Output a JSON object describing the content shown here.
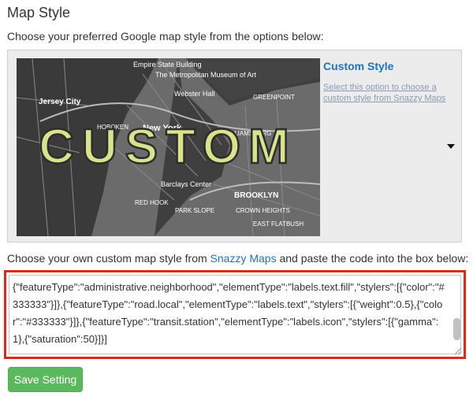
{
  "section": {
    "title": "Map Style",
    "subtitle": "Choose your preferred Google map style from the options below:"
  },
  "style_option": {
    "name": "Custom Style",
    "description": "Select this option to choose a custom style from Snazzy Maps",
    "preview_overlay_text": "CUSTOM"
  },
  "map_labels": {
    "empire": "Empire State Building",
    "museum": "The Metropolitan Museum of Art",
    "jersey": "Jersey City",
    "webster": "Webster Hall",
    "greenpoint": "GREENPOINT",
    "hoboken": "HOBOKEN",
    "newyork": "New York",
    "barclays": "Barclays Center",
    "brooklyn": "BROOKLYN",
    "park_slope": "PARK SLOPE",
    "crown": "CROWN HEIGHTS",
    "red_hook": "RED HOOK",
    "east_flatbush": "EAST FLATBUSH",
    "williamsburg": "WILLIAMSBURG"
  },
  "instructions": {
    "before": "Choose your own custom map style from ",
    "link": "Snazzy Maps",
    "after": " and paste the code into the box below:"
  },
  "code": {
    "value": "{\"featureType\":\"administrative.neighborhood\",\"elementType\":\"labels.text.fill\",\"stylers\":[{\"color\":\"#333333\"}]},{\"featureType\":\"road.local\",\"elementType\":\"labels.text\",\"stylers\":[{\"weight\":0.5},{\"color\":\"#333333\"}]},{\"featureType\":\"transit.station\",\"elementType\":\"labels.icon\",\"stylers\":[{\"gamma\":1},{\"saturation\":50}]}]"
  },
  "actions": {
    "save_label": "Save Setting"
  },
  "colors": {
    "accent": "#1e73be",
    "save_button": "#5cb85c",
    "highlight_border": "#e0281c",
    "overlay_text": "#e6f0a0"
  }
}
